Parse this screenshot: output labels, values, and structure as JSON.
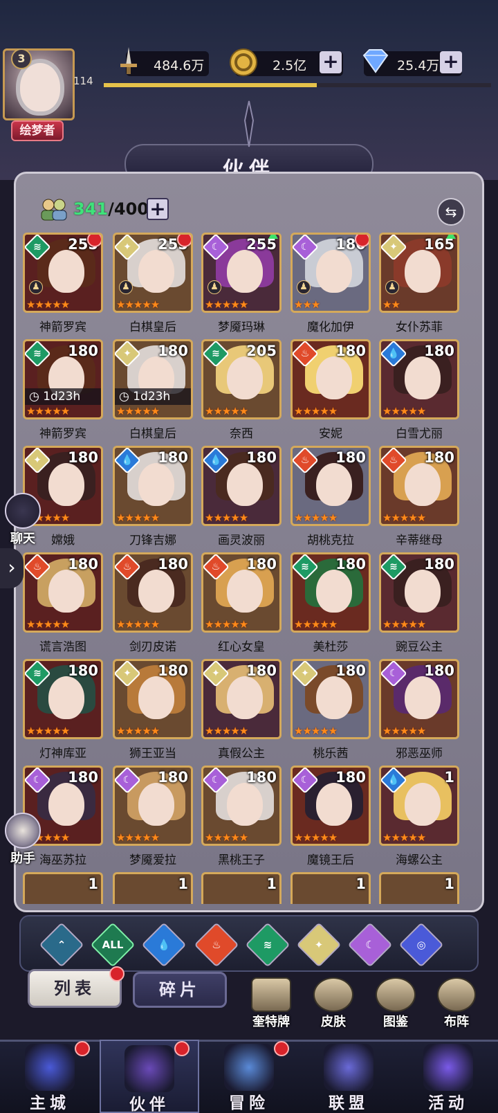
{
  "player": {
    "level": "3",
    "exp": "114",
    "title": "绘梦者",
    "exp_fill": 0.55
  },
  "resources": [
    {
      "name": "power",
      "value": "484.6万"
    },
    {
      "name": "gold",
      "value": "2.5亿"
    },
    {
      "name": "diamond",
      "value": "25.4万"
    }
  ],
  "header": {
    "title": "伙伴"
  },
  "roster": {
    "owned": "341",
    "capacity": "/400"
  },
  "colors": {
    "accent_gold": "#d5a95a",
    "badge_red": "#d8232a",
    "count_green": "#3fe27b"
  },
  "heroes": [
    {
      "name": "神箭罗宾",
      "level": "255",
      "element": "wind",
      "stars": 5,
      "badge": "red",
      "chess": true
    },
    {
      "name": "白棋皇后",
      "level": "255",
      "element": "light",
      "stars": 5,
      "badge": "red",
      "chess": true
    },
    {
      "name": "梦魇玛琳",
      "level": "255",
      "element": "dark",
      "stars": 5,
      "badge": "green",
      "chess": true
    },
    {
      "name": "魔化加伊",
      "level": "180",
      "element": "dark",
      "stars": 3,
      "badge": "red",
      "chess": true
    },
    {
      "name": "女仆苏菲",
      "level": "165",
      "element": "light",
      "stars": 2,
      "badge": "green",
      "chess": true
    },
    {
      "name": "神箭罗宾",
      "level": "180",
      "element": "wind",
      "stars": 5,
      "timer": "1d23h"
    },
    {
      "name": "白棋皇后",
      "level": "180",
      "element": "light",
      "stars": 5,
      "timer": "1d23h"
    },
    {
      "name": "奈西",
      "level": "205",
      "element": "wind",
      "stars": 5
    },
    {
      "name": "安妮",
      "level": "180",
      "element": "fire",
      "stars": 5
    },
    {
      "name": "白雪尤丽",
      "level": "180",
      "element": "water",
      "stars": 5
    },
    {
      "name": "嫦娥",
      "level": "180",
      "element": "light",
      "stars": 5
    },
    {
      "name": "刀锋吉娜",
      "level": "180",
      "element": "water",
      "stars": 5
    },
    {
      "name": "画灵波丽",
      "level": "180",
      "element": "water",
      "stars": 5
    },
    {
      "name": "胡桃克拉",
      "level": "180",
      "element": "fire",
      "stars": 5
    },
    {
      "name": "辛蒂继母",
      "level": "180",
      "element": "fire",
      "stars": 5
    },
    {
      "name": "谎言浩图",
      "level": "180",
      "element": "fire",
      "stars": 5
    },
    {
      "name": "剑刃皮诺",
      "level": "180",
      "element": "fire",
      "stars": 5
    },
    {
      "name": "红心女皇",
      "level": "180",
      "element": "fire",
      "stars": 5
    },
    {
      "name": "美杜莎",
      "level": "180",
      "element": "wind",
      "stars": 5
    },
    {
      "name": "豌豆公主",
      "level": "180",
      "element": "wind",
      "stars": 5
    },
    {
      "name": "灯神库亚",
      "level": "180",
      "element": "wind",
      "stars": 5
    },
    {
      "name": "狮王亚当",
      "level": "180",
      "element": "light",
      "stars": 5
    },
    {
      "name": "真假公主",
      "level": "180",
      "element": "light",
      "stars": 5
    },
    {
      "name": "桃乐茜",
      "level": "180",
      "element": "light",
      "stars": 5
    },
    {
      "name": "邪恶巫师",
      "level": "180",
      "element": "dark",
      "stars": 5
    },
    {
      "name": "海巫苏拉",
      "level": "180",
      "element": "dark",
      "stars": 5
    },
    {
      "name": "梦魇爱拉",
      "level": "180",
      "element": "dark",
      "stars": 5
    },
    {
      "name": "黑桃王子",
      "level": "180",
      "element": "dark",
      "stars": 5
    },
    {
      "name": "魔镜王后",
      "level": "180",
      "element": "dark",
      "stars": 5
    },
    {
      "name": "海螺公主",
      "level": "1",
      "element": "water",
      "stars": 5
    }
  ],
  "partial_row_levels": [
    "1",
    "1",
    "1",
    "1",
    "1"
  ],
  "filters": [
    "base",
    "ALL",
    "water",
    "fire",
    "wind",
    "light",
    "dark",
    "cosmic"
  ],
  "filter_all_label": "ALL",
  "tabs": {
    "list": "列表",
    "fragments": "碎片"
  },
  "side": {
    "chat": "聊天",
    "assistant": "助手"
  },
  "quick_actions": [
    "奎特牌",
    "皮肤",
    "图鉴",
    "布阵"
  ],
  "nav": [
    {
      "label": "主城",
      "badge": true
    },
    {
      "label": "伙伴",
      "badge": true,
      "active": true
    },
    {
      "label": "冒险",
      "badge": true
    },
    {
      "label": "联盟",
      "badge": false
    },
    {
      "label": "活动",
      "badge": false
    }
  ]
}
